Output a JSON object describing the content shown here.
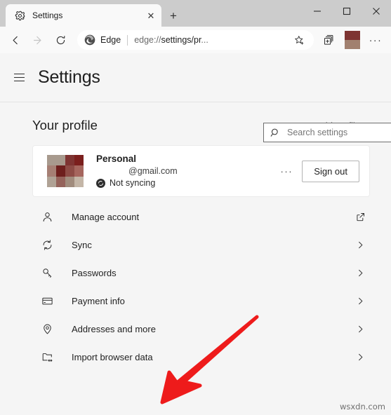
{
  "window": {
    "tab": {
      "title": "Settings",
      "favicon": "gear-icon",
      "close_label": "✕"
    },
    "new_tab_label": "+",
    "controls": {
      "minimize": "─",
      "maximize": "□",
      "close": "✕"
    }
  },
  "toolbar": {
    "back": "back-arrow",
    "forward": "forward-arrow",
    "refresh": "refresh-arrow",
    "omnibox": {
      "brand": "Edge",
      "url_prefix": "edge://",
      "url_strong": "settings/pr",
      "url_suffix": "...",
      "favorite_icon": "star-add-icon"
    },
    "collections_icon": "collections-icon",
    "profile_icon": "profile-avatar",
    "more_label": "···"
  },
  "settings": {
    "hamburger_label": "menu-icon",
    "title": "Settings",
    "search": {
      "placeholder": "Search settings",
      "value": ""
    }
  },
  "profile_section": {
    "heading": "Your profile",
    "add_profile": {
      "plus": "+",
      "label": "Add profile"
    },
    "card": {
      "name": "Personal",
      "email": "@gmail.com",
      "sync_status": "Not syncing",
      "more_label": "···",
      "sign_out_label": "Sign out",
      "avatar_colors": [
        "#a89a8e",
        "#a89a8e",
        "#7e3432",
        "#7b1f1d",
        "#a67f74",
        "#6e1f1d",
        "#8d4b45",
        "#a6665e",
        "#b0a295",
        "#95635b",
        "#a18c7d",
        "#c4b6a7"
      ]
    }
  },
  "list_items": [
    {
      "icon": "person-icon",
      "label": "Manage account",
      "trailing": "external-link-icon"
    },
    {
      "icon": "sync-icon",
      "label": "Sync",
      "trailing": "chevron-right-icon"
    },
    {
      "icon": "key-icon",
      "label": "Passwords",
      "trailing": "chevron-right-icon"
    },
    {
      "icon": "credit-card-icon",
      "label": "Payment info",
      "trailing": "chevron-right-icon"
    },
    {
      "icon": "location-pin-icon",
      "label": "Addresses and more",
      "trailing": "chevron-right-icon"
    },
    {
      "icon": "import-folder-icon",
      "label": "Import browser data",
      "trailing": "chevron-right-icon"
    }
  ],
  "annotation": {
    "arrow_color": "#ee1b1b",
    "arrow_target": "Import browser data"
  },
  "watermark": "wsxdn.com"
}
